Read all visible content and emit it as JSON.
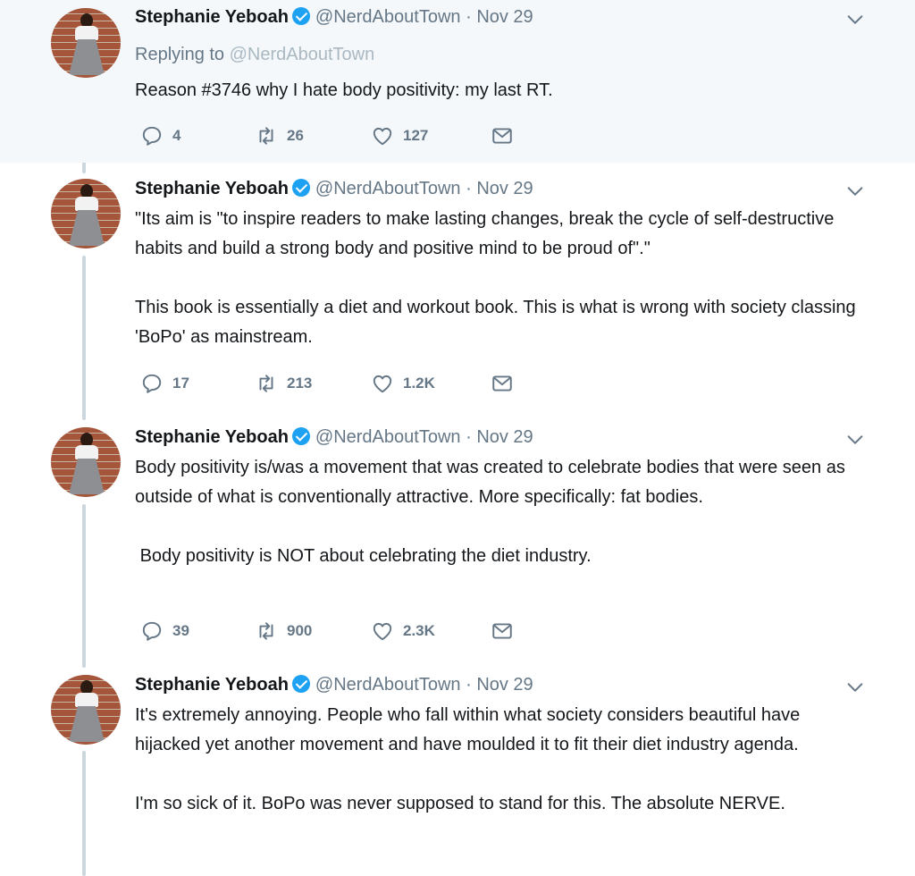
{
  "tweets": [
    {
      "name": "Stephanie Yeboah",
      "handle": "@NerdAboutTown",
      "sep": "·",
      "date": "Nov 29",
      "replying_prefix": "Replying to",
      "replying_to": "@NerdAboutTown",
      "paragraphs": [
        "Reason #3746 why I hate body positivity: my last RT."
      ],
      "replies": "4",
      "retweets": "26",
      "likes": "127"
    },
    {
      "name": "Stephanie Yeboah",
      "handle": "@NerdAboutTown",
      "sep": "·",
      "date": "Nov 29",
      "paragraphs": [
        "\"Its aim is \"to inspire readers to make lasting changes, break the cycle of self-destructive habits and build a strong body and positive mind to be proud of\".\"",
        "This book is essentially a diet and workout book. This is what is wrong with society classing 'BoPo' as mainstream."
      ],
      "replies": "17",
      "retweets": "213",
      "likes": "1.2K"
    },
    {
      "name": "Stephanie Yeboah",
      "handle": "@NerdAboutTown",
      "sep": "·",
      "date": "Nov 29",
      "paragraphs": [
        "Body positivity is/was a movement that was created to celebrate bodies that were seen as outside of what is conventionally attractive. More specifically: fat bodies.",
        " Body positivity is NOT about celebrating the diet industry."
      ],
      "replies": "39",
      "retweets": "900",
      "likes": "2.3K"
    },
    {
      "name": "Stephanie Yeboah",
      "handle": "@NerdAboutTown",
      "sep": "·",
      "date": "Nov 29",
      "paragraphs": [
        "It's extremely annoying. People who fall within what society considers beautiful have hijacked yet another movement and have moulded it to fit their diet industry agenda.",
        "I'm so sick of it. BoPo was never supposed to stand for this. The absolute NERVE."
      ]
    }
  ],
  "icons": {
    "verified": "verified-badge-icon",
    "menu": "chevron-down-icon",
    "reply": "reply-icon",
    "retweet": "retweet-icon",
    "like": "heart-icon",
    "dm": "envelope-icon"
  },
  "colors": {
    "highlight_bg": "#f5f8fa",
    "muted": "#657786",
    "verified": "#1da1f2",
    "thread_line": "#ccd6dd"
  }
}
